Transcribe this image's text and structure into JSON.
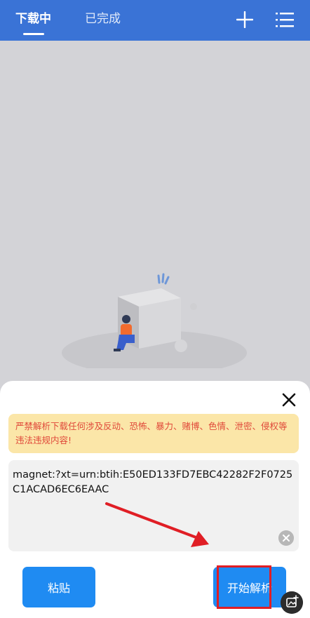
{
  "header": {
    "tabs": [
      {
        "label": "下载中",
        "active": true
      },
      {
        "label": "已完成",
        "active": false
      }
    ],
    "add_icon": "plus-icon",
    "menu_icon": "list-menu-icon",
    "accent_color": "#3a73d6"
  },
  "dialog": {
    "warning_text": "严禁解析下载任何涉及反动、恐怖、暴力、赌博、色情、泄密、侵权等违法违规内容!",
    "link_value": "magnet:?xt=urn:btih:E50ED133FD7EBC42282F2F0725C1ACAD6EC6EAAC",
    "paste_label": "粘贴",
    "parse_label": "开始解析",
    "button_color": "#1f8bf2",
    "warning_text_color": "#e0493a"
  }
}
